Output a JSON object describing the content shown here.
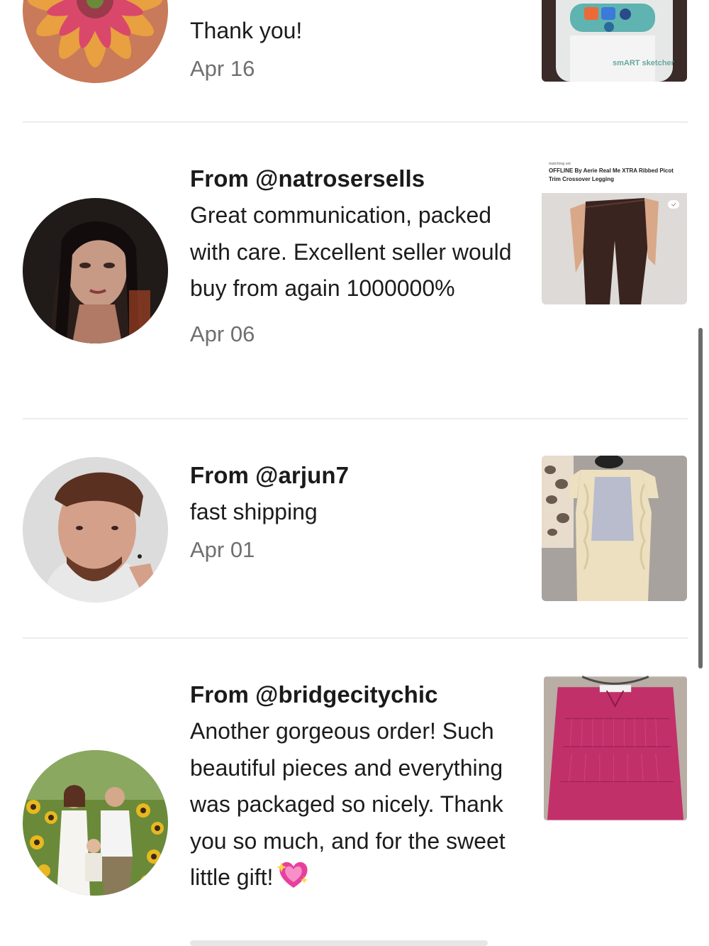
{
  "reviews": [
    {
      "body": "Thank you!",
      "date": "Apr 16",
      "avatar": "flower-avatar",
      "thumb": "smart-sketcher-toy",
      "thumb_text": "smART sketcher"
    },
    {
      "from": "From @natrosersells",
      "body": "Great communication, packed with care. Excellent seller would buy from again 1000000%",
      "date": "Apr 06",
      "avatar": "woman-portrait-avatar",
      "thumb": "legging-listing",
      "thumb_caption_small": "matching set",
      "thumb_caption": "OFFLINE By Aerie Real Me XTRA Ribbed Picot Trim Crossover Legging"
    },
    {
      "from": "From @arjun7",
      "body": "fast shipping",
      "date": "Apr 01",
      "avatar": "man-portrait-avatar",
      "thumb": "lace-blouse"
    },
    {
      "from": "From @bridgecitychic",
      "body": "Another gorgeous order! Such beautiful pieces and everything was packaged so nicely. Thank you so much, and for the sweet little gift!",
      "date": "",
      "avatar": "family-sunflower-avatar",
      "thumb": "pink-ruffle-top",
      "emoji": "sparkling-heart-icon"
    }
  ],
  "colors": {
    "date": "#6f6f6f",
    "divider": "#ececec",
    "pink_top": "#c2306a"
  }
}
